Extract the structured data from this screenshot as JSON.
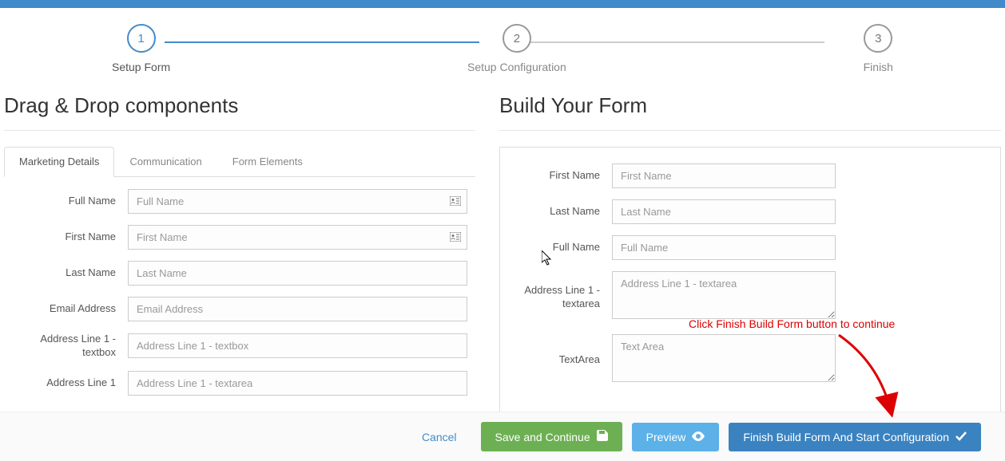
{
  "stepper": {
    "steps": [
      {
        "num": "1",
        "label": "Setup Form",
        "active": true
      },
      {
        "num": "2",
        "label": "Setup Configuration",
        "active": false
      },
      {
        "num": "3",
        "label": "Finish",
        "active": false
      }
    ]
  },
  "left": {
    "title": "Drag & Drop components",
    "tabs": [
      {
        "label": "Marketing Details",
        "active": true
      },
      {
        "label": "Communication",
        "active": false
      },
      {
        "label": "Form Elements",
        "active": false
      }
    ],
    "fields": [
      {
        "label": "Full Name",
        "placeholder": "Full Name",
        "icon": true
      },
      {
        "label": "First Name",
        "placeholder": "First Name",
        "icon": true
      },
      {
        "label": "Last Name",
        "placeholder": "Last Name",
        "icon": false
      },
      {
        "label": "Email Address",
        "placeholder": "Email Address",
        "icon": false
      },
      {
        "label": "Address Line 1 - textbox",
        "placeholder": "Address Line 1 - textbox",
        "icon": false
      },
      {
        "label": "Address Line 1",
        "placeholder": "Address Line 1 - textarea",
        "icon": false
      }
    ]
  },
  "right": {
    "title": "Build Your Form",
    "fields": [
      {
        "label": "First Name",
        "placeholder": "First Name",
        "type": "text"
      },
      {
        "label": "Last Name",
        "placeholder": "Last Name",
        "type": "text"
      },
      {
        "label": "Full Name",
        "placeholder": "Full Name",
        "type": "text"
      },
      {
        "label": "Address Line 1 - textarea",
        "placeholder": "Address Line 1 - textarea",
        "type": "textarea"
      },
      {
        "label": "TextArea",
        "placeholder": "Text Area",
        "type": "textarea"
      }
    ]
  },
  "footer": {
    "cancel": "Cancel",
    "save": "Save and Continue",
    "preview": "Preview",
    "finish": "Finish Build Form And Start Configuration"
  },
  "annotation": "Click Finish Build Form button to continue"
}
